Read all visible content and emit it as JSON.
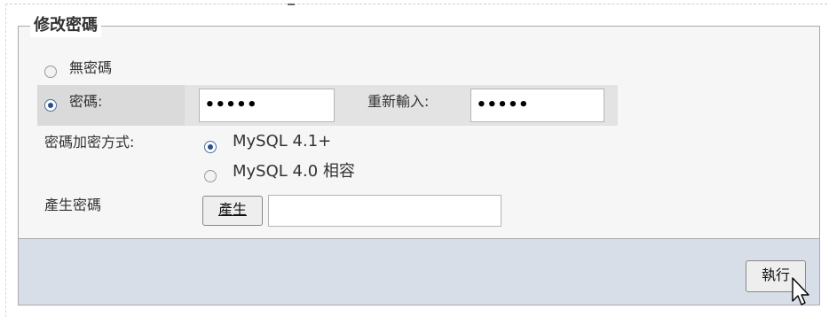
{
  "fieldset": {
    "legend": "修改密碼"
  },
  "no_password": {
    "label": "無密碼",
    "selected": false
  },
  "password": {
    "label": "密碼:",
    "selected": true,
    "value": "•••••",
    "reenter_label": "重新輸入:",
    "reenter_value": "•••••"
  },
  "hashing": {
    "label": "密碼加密方式:",
    "options": [
      {
        "label": "MySQL 4.1+",
        "selected": true
      },
      {
        "label": "MySQL 4.0 相容",
        "selected": false
      }
    ]
  },
  "generate": {
    "label": "產生密碼",
    "button_label": "產生",
    "output_value": ""
  },
  "footer": {
    "go_label": "執行"
  },
  "icons": {
    "cursor": "mouse-pointer-icon"
  }
}
